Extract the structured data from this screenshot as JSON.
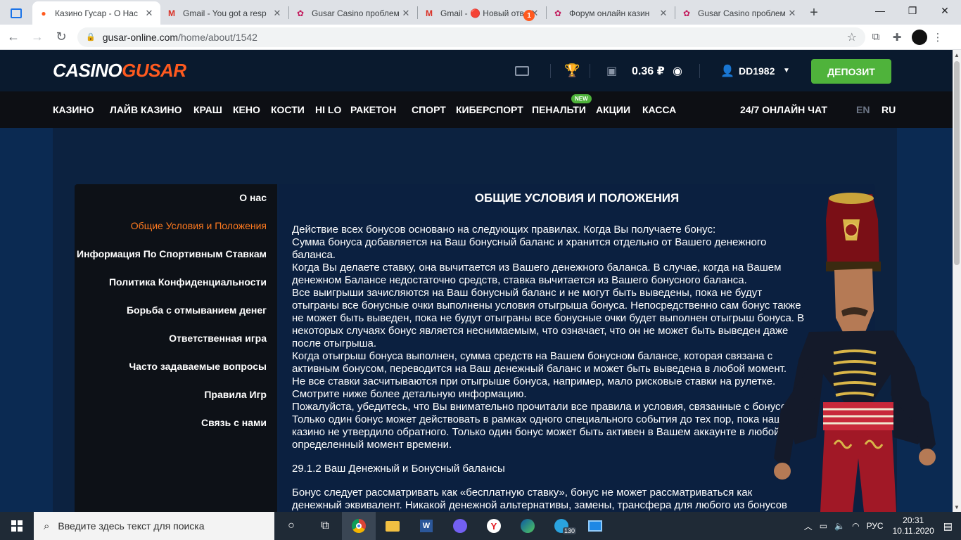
{
  "browser": {
    "tabs": [
      {
        "title": "Казино Гусар - О Нас",
        "active": true
      },
      {
        "title": "Gmail - You got a resp"
      },
      {
        "title": "Gusar Casino проблем"
      },
      {
        "title": "Gmail - 🔴 Новый отв"
      },
      {
        "title": "Форум онлайн казин"
      },
      {
        "title": "Gusar Casino проблем"
      }
    ],
    "url_domain": "gusar-online.com",
    "url_path": "/home/about/1542"
  },
  "header": {
    "logo_part1": "CASINO",
    "logo_part2": "GUSAR",
    "mail_count": "1",
    "balance": "0.36 ₽",
    "username": "DD1982",
    "deposit_label": "ДЕПОЗИТ"
  },
  "nav": {
    "items": [
      "КАЗИНО",
      "ЛАЙВ КАЗИНО",
      "КРАШ",
      "КЕНО",
      "КОСТИ",
      "HI LO",
      "РАКЕТОН",
      "СПОРТ",
      "КИБЕРСПОРТ",
      "ПЕНАЛЬТИ",
      "АКЦИИ",
      "КАССА"
    ],
    "new_badge": "NEW",
    "chat": "24/7 ОНЛАЙН ЧАТ",
    "lang_en": "EN",
    "lang_ru": "RU"
  },
  "sidebar": {
    "items": [
      "О нас",
      "Общие Условия и Положения",
      "Информация По Спортивным Ставкам",
      "Политика Конфиденциальности",
      "Борьба с отмыванием денег",
      "Ответственная игра",
      "Часто задаваемые вопросы",
      "Правила Игр",
      "Связь с нами"
    ]
  },
  "article": {
    "title": "ОБЩИЕ УСЛОВИЯ И ПОЛОЖЕНИЯ",
    "lines": [
      "Действие всех бонусов основано на следующих правилах. Когда Вы получаете бонус:",
      "Сумма бонуса добавляется на Ваш бонусный баланс и хранится отдельно от Вашего денежного",
      "баланса.",
      "Когда Вы делаете ставку, она вычитается из Вашего денежного баланса. В случае, когда на Вашем",
      "денежном Балансе недостаточно средств, ставка вычитается из Вашего бонусного баланса.",
      "Все выигрыши зачисляются на Ваш бонусный баланс и не могут быть выведены, пока не будут",
      "отыграны все бонусные очки выполнены условия отыгрыша бонуса. Непосредственно сам бонус также",
      "не может быть выведен, пока не будут отыграны все бонусные очки будет выполнен отыгрыш бонуса. В",
      "некоторых случаях бонус является неснимаемым, что означает, что он не может быть выведен даже",
      "после отыгрыша.",
      "Когда отыгрыш бонуса выполнен, сумма средств на Вашем бонусном балансе, которая связана с",
      "активным бонусом, переводится на Ваш денежный баланс и может быть выведена в любой момент.",
      "Не все ставки засчитываются при отыгрыше бонуса, например, мало рисковые ставки на рулетке.",
      "Смотрите ниже более детальную информацию.",
      "Пожалуйста, убедитесь, что Вы внимательно прочитали все правила и условия, связанные с бонусом.",
      "Только один бонус может действовать в рамках одного специального события до тех пор, пока наше",
      "казино не утвердило обратного. Только один бонус может быть активен в Вашем аккаунте в любой",
      "определенный момент времени."
    ],
    "subheading": "29.1.2 Ваш Денежный и Бонусный балансы",
    "lines2": [
      "Бонус следует рассматривать как «бесплатную ставку», бонус не может рассматриваться как",
      "денежный эквивалент. Никакой денежной альтернативы, замены, трансфера для любого из бонусов"
    ]
  },
  "taskbar": {
    "search_placeholder": "Введите здесь текст для поиска",
    "telegram_badge": "130",
    "lang": "РУС",
    "time": "20:31",
    "date": "10.11.2020"
  },
  "colors": {
    "accent": "#ff5a1f",
    "deposit": "#4fb33b",
    "active_side": "#ff7a1f"
  }
}
